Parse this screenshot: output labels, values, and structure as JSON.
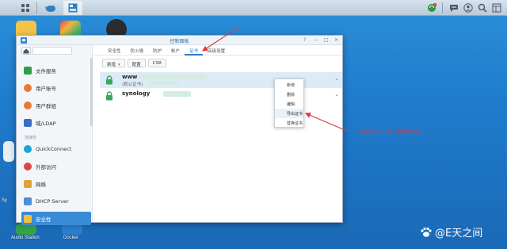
{
  "taskbar": {
    "icons": [
      "grid-icon",
      "mascot-icon",
      "control-panel-icon"
    ],
    "right_icons": [
      "sync-icon",
      "chat-icon",
      "user-icon",
      "search-icon",
      "widgets-icon"
    ],
    "badge_color": "#e84545"
  },
  "desktop": {
    "labels": {
      "audio_station": "Audio Station",
      "docker": "Docker",
      "sy_edge": "Sy"
    }
  },
  "window": {
    "title": "控制面板",
    "controls": [
      "?",
      "—",
      "□",
      "✕"
    ],
    "sidebar": {
      "items": [
        {
          "label": "文件服务",
          "icon": "file-service-icon",
          "color": "#2e9e4e"
        },
        {
          "label": "用户账号",
          "icon": "user-account-icon",
          "color": "#e8773a"
        },
        {
          "label": "用户群组",
          "icon": "user-group-icon",
          "color": "#e8773a"
        },
        {
          "label": "域/LDAP",
          "icon": "domain-ldap-icon",
          "color": "#3a6fc4"
        },
        {
          "label": "QuickConnect",
          "icon": "quickconnect-icon",
          "color": "#1ba5d8"
        },
        {
          "label": "外部访问",
          "icon": "external-access-icon",
          "color": "#d84848"
        },
        {
          "label": "网络",
          "icon": "network-icon",
          "color": "#e0a23a"
        },
        {
          "label": "DHCP Server",
          "icon": "dhcp-server-icon",
          "color": "#4b8fd6"
        },
        {
          "label": "安全性",
          "icon": "security-icon",
          "color": "#f0c23a"
        }
      ],
      "group_label": "连接性"
    },
    "tabs": [
      {
        "label": "安全性"
      },
      {
        "label": "防火墙"
      },
      {
        "label": "防护"
      },
      {
        "label": "帐户"
      },
      {
        "label": "证书"
      },
      {
        "label": "高级设置"
      }
    ],
    "active_tab": 4,
    "toolbar": {
      "add_label": "新增",
      "configure_label": "配置",
      "csr_label": "CSR"
    },
    "certificates": [
      {
        "name": "www",
        "subtitle": "(默认证书)"
      },
      {
        "name": "synology",
        "subtitle": ""
      }
    ],
    "context_menu": {
      "items": [
        "新增",
        "删除",
        "编辑",
        "导出证书",
        "替换证书"
      ],
      "highlighted": 3
    }
  },
  "annotation": {
    "text": "选择对应的证书，然后导出证书",
    "color": "#e03a3a"
  },
  "watermark": {
    "text": "@E天之间"
  }
}
